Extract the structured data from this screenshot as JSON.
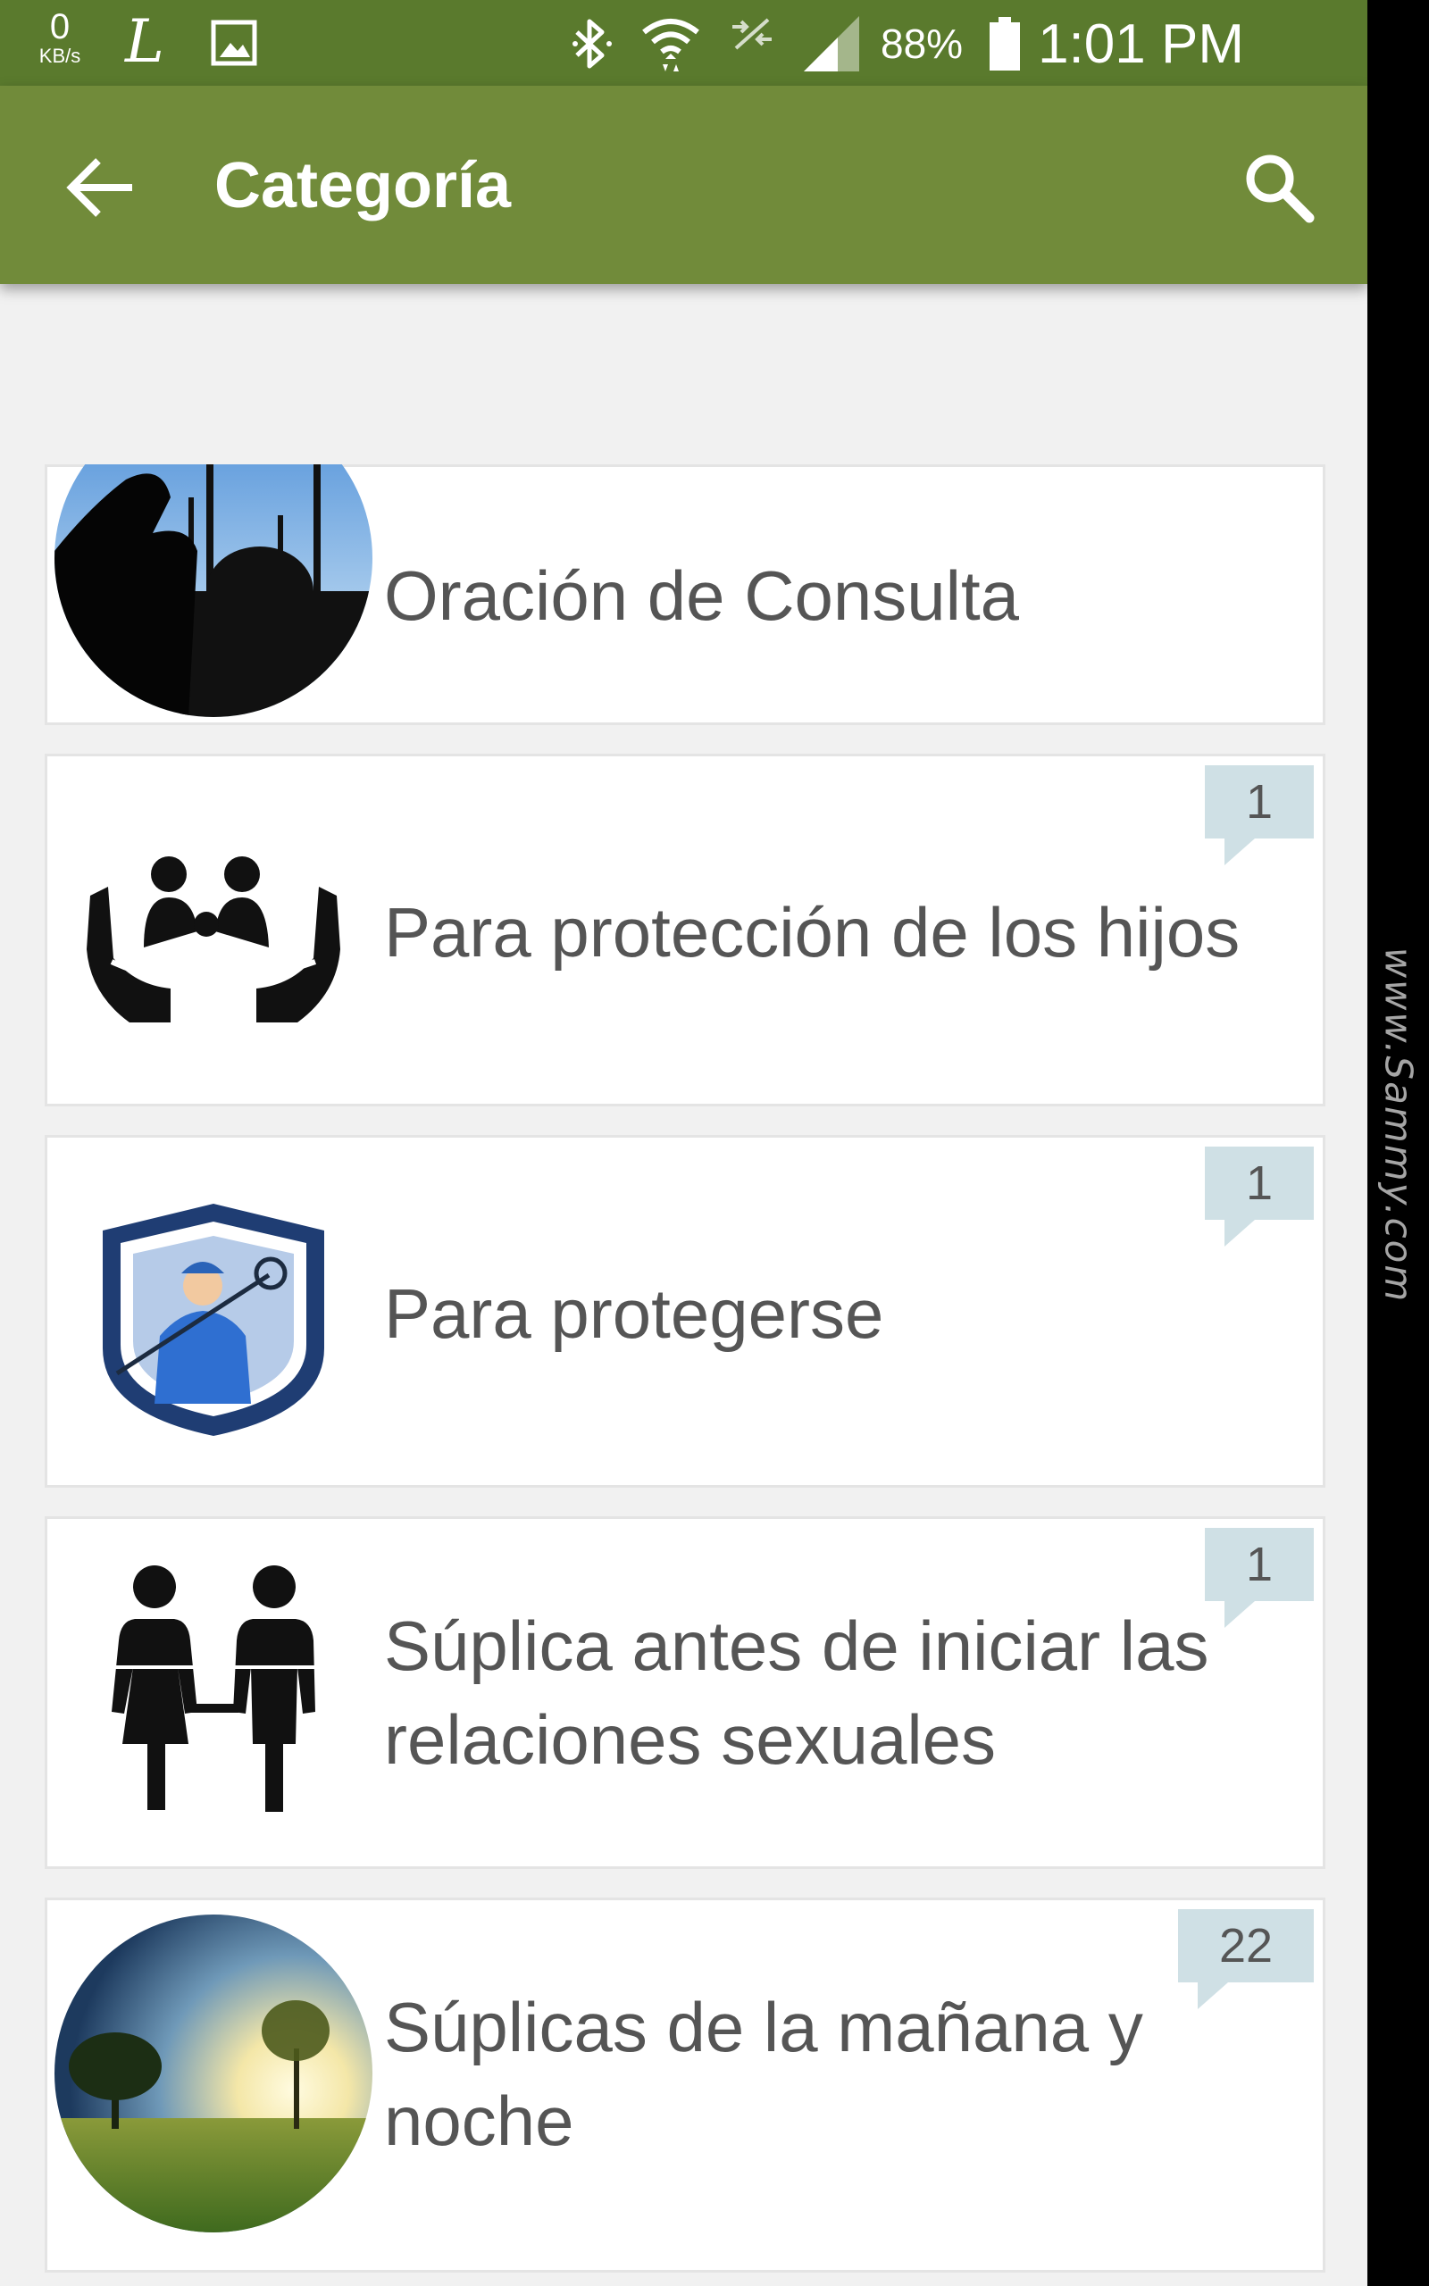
{
  "status_bar": {
    "net_speed_value": "0",
    "net_speed_unit": "KB/s",
    "app_glyph": "L",
    "battery_percent": "88%",
    "time": "1:01 PM"
  },
  "app_bar": {
    "title": "Categoría",
    "back_icon": "arrow-back-icon",
    "search_icon": "search-icon"
  },
  "categories": [
    {
      "label": "Oración de Consulta",
      "image": "mosque-silhouette-image"
    },
    {
      "label": "Para protección de los hijos",
      "badge": "1",
      "image": "hands-family-image"
    },
    {
      "label": "Para protegerse",
      "badge": "1",
      "image": "shield-chimney-sweep-image"
    },
    {
      "label": "Súplica antes de iniciar las relaciones sexuales",
      "badge": "1",
      "image": "couple-icon-image"
    },
    {
      "label": "Súplicas de la mañana y noche",
      "badge": "22",
      "image": "landscape-sunrise-image"
    }
  ],
  "watermark": "www.Sammy.com",
  "colors": {
    "status_bar": "#5a7a2d",
    "app_bar": "#718b3a",
    "badge": "#cfe0e5",
    "background": "#f1f1f1"
  }
}
